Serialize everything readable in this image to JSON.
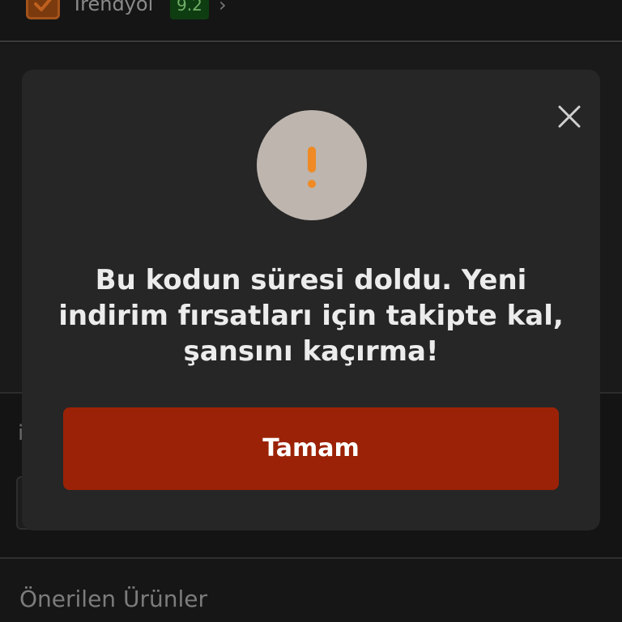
{
  "seller": {
    "name": "Trendyol",
    "rating": "9.2",
    "chevron": "›",
    "logo_icon": "check-badge-icon"
  },
  "background": {
    "partial_letter": "i",
    "recommended_title": "Önerilen Ürünler"
  },
  "modal": {
    "alert_icon": "exclamation-icon",
    "close_icon": "close-icon",
    "message_line1": "Bu kodun süresi doldu. Yeni",
    "message_line2": "indirim fırsatları için takipte kal,",
    "message_line3": "şansını kaçırma!",
    "ok_label": "Tamam"
  },
  "colors": {
    "accent_button": "#9b2206",
    "alert_mark": "#f08a24",
    "alert_circle": "#bdb5ae",
    "modal_bg": "#262626"
  }
}
